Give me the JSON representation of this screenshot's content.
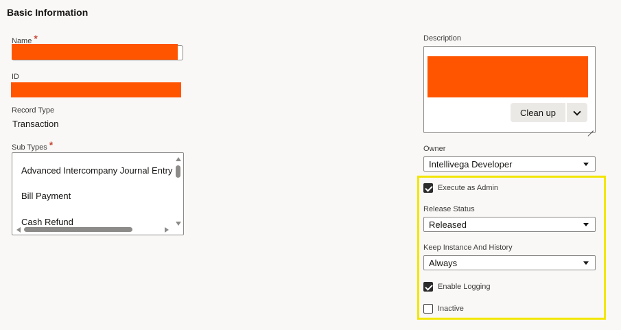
{
  "section": {
    "title": "Basic Information"
  },
  "name_field": {
    "label": "Name",
    "required_mark": "*",
    "value": ""
  },
  "id_field": {
    "label": "ID",
    "value": ""
  },
  "record_type": {
    "label": "Record Type",
    "value": "Transaction"
  },
  "sub_types": {
    "label": "Sub Types",
    "required_mark": "*",
    "items": [
      "Advanced Intercompany Journal Entry",
      "Bill Payment",
      "Cash Refund"
    ]
  },
  "description": {
    "label": "Description",
    "value": "",
    "cleanup_label": "Clean up"
  },
  "owner": {
    "label": "Owner",
    "value": "Intellivega Developer"
  },
  "execute_as_admin": {
    "label": "Execute as Admin",
    "checked": true
  },
  "release_status": {
    "label": "Release Status",
    "value": "Released"
  },
  "keep_instance": {
    "label": "Keep Instance And History",
    "value": "Always"
  },
  "enable_logging": {
    "label": "Enable Logging",
    "checked": true
  },
  "inactive": {
    "label": "Inactive",
    "checked": false
  },
  "colors": {
    "redaction": "#ff5500",
    "highlight": "#f2e600",
    "required": "#c74634"
  },
  "icons": {
    "cleanup_dropdown": "chevron-down-icon",
    "select_caret": "caret-down-icon",
    "checked": "checkmark-icon"
  }
}
